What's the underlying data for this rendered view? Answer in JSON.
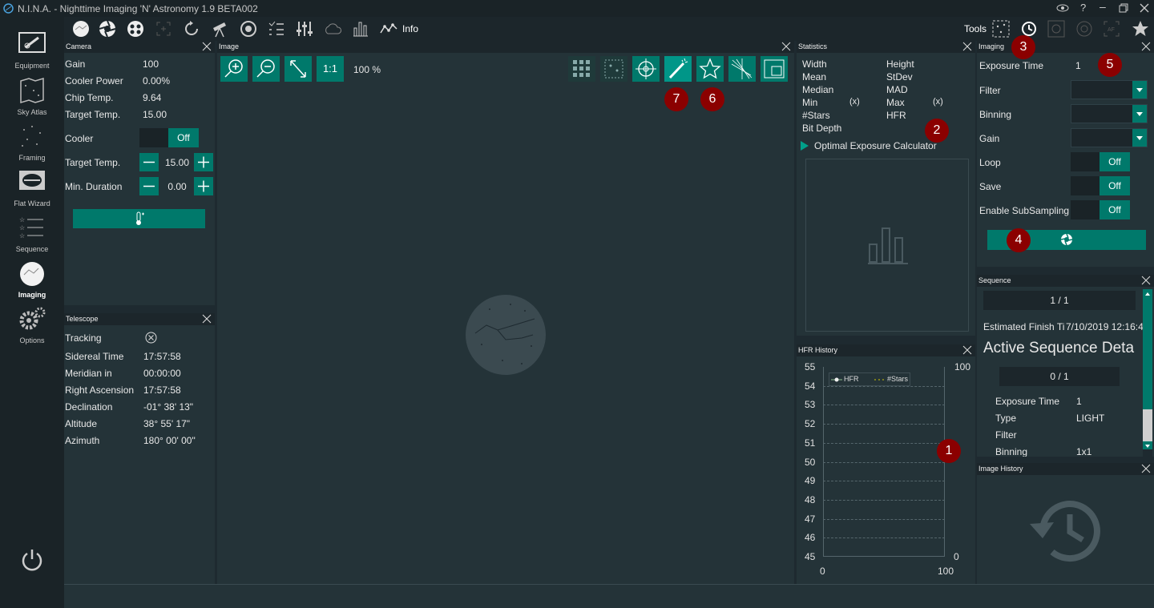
{
  "window": {
    "title": "N.I.N.A. - Nighttime Imaging 'N' Astronomy 1.9 BETA002"
  },
  "toolbar": {
    "info_label": "Info",
    "tools_label": "Tools"
  },
  "nav": [
    {
      "label": "Equipment",
      "icon": "equipment-icon"
    },
    {
      "label": "Sky Atlas",
      "icon": "sky-atlas-icon"
    },
    {
      "label": "Framing",
      "icon": "framing-icon"
    },
    {
      "label": "Flat Wizard",
      "icon": "flat-wizard-icon"
    },
    {
      "label": "Sequence",
      "icon": "sequence-icon"
    },
    {
      "label": "Imaging",
      "icon": "imaging-icon"
    },
    {
      "label": "Options",
      "icon": "options-icon"
    }
  ],
  "camera": {
    "title": "Camera",
    "rows": [
      {
        "label": "Gain",
        "value": "100"
      },
      {
        "label": "Cooler Power",
        "value": "0.00%"
      },
      {
        "label": "Chip Temp.",
        "value": "9.64"
      },
      {
        "label": "Target Temp.",
        "value": "15.00"
      }
    ],
    "cooler_label": "Cooler",
    "cooler_state": "Off",
    "target_temp_label": "Target Temp.",
    "target_temp_value": "15.00",
    "min_duration_label": "Min. Duration",
    "min_duration_value": "0.00"
  },
  "telescope": {
    "title": "Telescope",
    "rows": [
      {
        "label": "Tracking",
        "value": ""
      },
      {
        "label": "Sidereal Time",
        "value": "17:57:58"
      },
      {
        "label": "Meridian in",
        "value": "00:00:00"
      },
      {
        "label": "Right Ascension",
        "value": "17:57:58"
      },
      {
        "label": "Declination",
        "value": "-01° 38' 13\""
      },
      {
        "label": "Altitude",
        "value": "38° 55' 17\""
      },
      {
        "label": "Azimuth",
        "value": "180° 00' 00\""
      }
    ]
  },
  "image": {
    "title": "Image",
    "one_to_one": "1:1",
    "zoom": "100 %"
  },
  "statistics": {
    "title": "Statistics",
    "left": [
      "Width",
      "Mean",
      "Median",
      "Min",
      "#Stars",
      "Bit Depth"
    ],
    "right": [
      "Height",
      "StDev",
      "MAD",
      "Max",
      "HFR"
    ],
    "min_x": "(x)",
    "max_x": "(x)",
    "calculator": "Optimal Exposure Calculator"
  },
  "hfr": {
    "title": "HFR History",
    "legend": [
      "HFR",
      "#Stars"
    ],
    "y_left": [
      "55",
      "54",
      "53",
      "52",
      "51",
      "50",
      "49",
      "48",
      "47",
      "46",
      "45"
    ],
    "y_right_top": "100",
    "y_right_bottom": "0",
    "x_left": "0",
    "x_right": "100"
  },
  "imaging": {
    "title": "Imaging",
    "exposure_label": "Exposure Time",
    "exposure_value": "1",
    "filter_label": "Filter",
    "binning_label": "Binning",
    "gain_label": "Gain",
    "loop_label": "Loop",
    "loop_state": "Off",
    "save_label": "Save",
    "save_state": "Off",
    "subsampling_label": "Enable SubSampling",
    "subsampling_state": "Off"
  },
  "sequence": {
    "title": "Sequence",
    "progress": "1 / 1",
    "finish_label": "Estimated Finish Ti",
    "finish_value": "7/10/2019 12:16:4",
    "active_title": "Active Sequence Deta",
    "sub_progress": "0 / 1",
    "rows": [
      {
        "label": "Exposure Time",
        "value": "1"
      },
      {
        "label": "Type",
        "value": "LIGHT"
      },
      {
        "label": "Filter",
        "value": ""
      },
      {
        "label": "Binning",
        "value": "1x1"
      }
    ]
  },
  "image_history": {
    "title": "Image History"
  },
  "badges": [
    "1",
    "2",
    "3",
    "4",
    "5",
    "6",
    "7"
  ],
  "colors": {
    "accent": "#00796b",
    "background": "#243338",
    "badge": "#8b0000"
  }
}
